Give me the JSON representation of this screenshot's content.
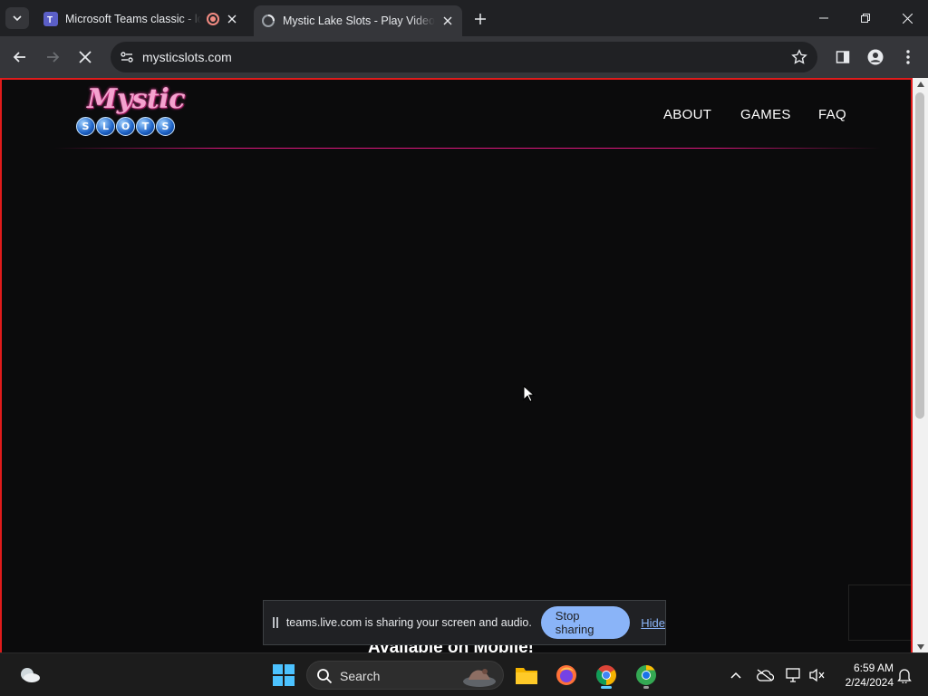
{
  "browser": {
    "tabs": [
      {
        "title": "Microsoft Teams classic - lo",
        "favicon": "teams-icon",
        "recording": true
      },
      {
        "title": "Mystic Lake Slots - Play Video F",
        "favicon": "loading-icon",
        "active": true
      }
    ],
    "url": "mysticslots.com",
    "accent": "#8ab4f8"
  },
  "site": {
    "logo": {
      "word": "Mystic",
      "balls": [
        "S",
        "L",
        "O",
        "T",
        "S"
      ]
    },
    "nav": {
      "about": "ABOUT",
      "games": "GAMES",
      "faq": "FAQ"
    },
    "mobile_text": "Available on Mobile!",
    "brand_pink": "#e0177f",
    "share_border_color": "#e01b1b"
  },
  "share_bar": {
    "message": "teams.live.com is sharing your screen and audio.",
    "stop_label": "Stop sharing",
    "hide_label": "Hide"
  },
  "taskbar": {
    "search_label": "Search",
    "time": "6:59 AM",
    "date": "2/24/2024"
  }
}
